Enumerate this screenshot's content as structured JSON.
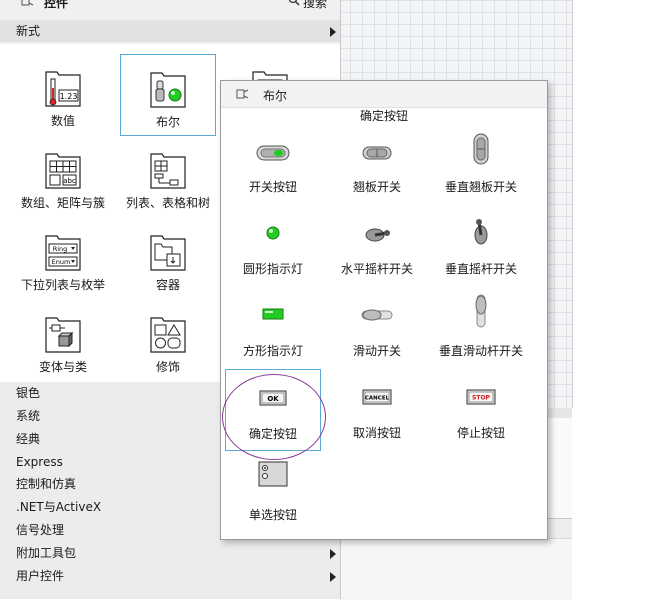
{
  "palette": {
    "title": "控件",
    "search_label": "搜索",
    "new_section": "新式",
    "items": [
      {
        "label": "数值"
      },
      {
        "label": "布尔"
      },
      {
        "label": "数组、矩阵与簇"
      },
      {
        "label": "列表、表格和树"
      },
      {
        "label": "下拉列表与枚举"
      },
      {
        "label": "容器"
      },
      {
        "label": "变体与类"
      },
      {
        "label": "修饰"
      }
    ],
    "numeric_icon_text": "1.23",
    "string_icon_text": "abc",
    "ring_icon_text": "Ring",
    "enum_icon_text": "Enum",
    "list": [
      {
        "label": "银色",
        "has_submenu": false
      },
      {
        "label": "系统",
        "has_submenu": false
      },
      {
        "label": "经典",
        "has_submenu": false
      },
      {
        "label": "Express",
        "has_submenu": false
      },
      {
        "label": "控制和仿真",
        "has_submenu": false
      },
      {
        "label": ".NET与ActiveX",
        "has_submenu": false
      },
      {
        "label": "信号处理",
        "has_submenu": false
      },
      {
        "label": "附加工具包",
        "has_submenu": true
      },
      {
        "label": "用户控件",
        "has_submenu": true
      }
    ]
  },
  "boolean_popup": {
    "title": "布尔",
    "hover_label": "确定按钮",
    "controls": [
      {
        "label": "开关按钮"
      },
      {
        "label": "翘板开关"
      },
      {
        "label": "垂直翘板开关"
      },
      {
        "label": "圆形指示灯"
      },
      {
        "label": "水平摇杆开关"
      },
      {
        "label": "垂直摇杆开关"
      },
      {
        "label": "方形指示灯"
      },
      {
        "label": "滑动开关"
      },
      {
        "label": "垂直滑动杆开关"
      },
      {
        "label": "确定按钮"
      },
      {
        "label": "取消按钮"
      },
      {
        "label": "停止按钮"
      },
      {
        "label": "单选按钮"
      }
    ],
    "ok_text": "OK",
    "cancel_text": "CANCEL",
    "stop_text": "STOP"
  },
  "colors": {
    "selection_border": "#5aa9d8",
    "annotation_circle": "#8a3a9a",
    "led_green": "#22cc22",
    "stop_red": "#cc2222"
  }
}
